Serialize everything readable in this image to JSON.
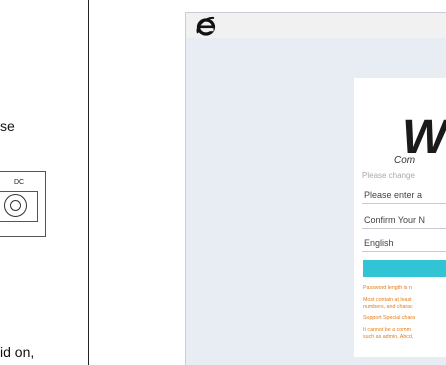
{
  "document": {
    "line1": "se",
    "line2": "id on,",
    "dc_label": "DC"
  },
  "browser": {
    "icon": "internet-explorer-icon"
  },
  "login": {
    "logo": "W",
    "logo_sub": "Com",
    "hint": "Please change",
    "password_placeholder": "Please enter a",
    "confirm_placeholder": "Confirm Your N",
    "language_value": "English",
    "submit_color": "#30c4d4",
    "notes": [
      "Password length is n",
      "Most contain at least",
      "numbers, and charac",
      "Support Special chara",
      "It cannot be a comm",
      "such as admin, Abcd,"
    ],
    "note_color": "#e07d1c"
  }
}
